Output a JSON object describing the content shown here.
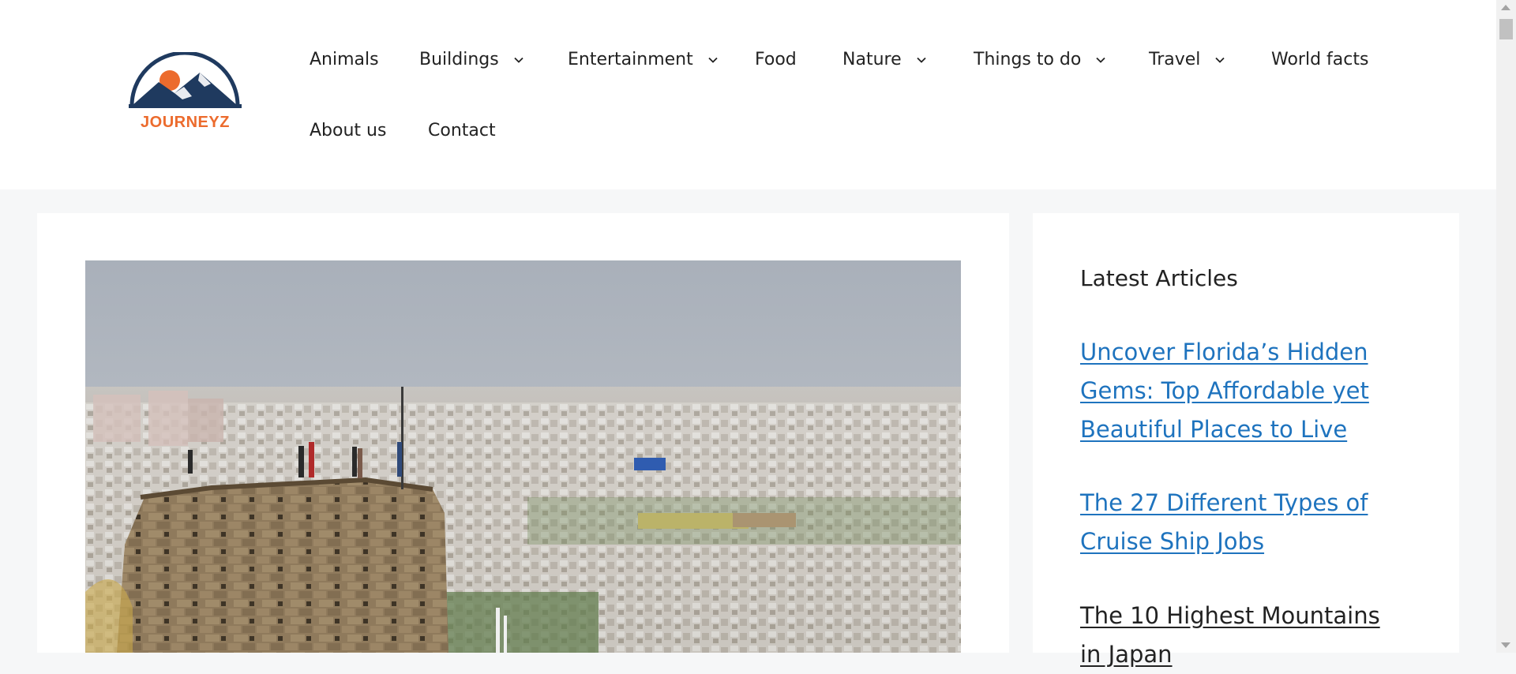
{
  "brand": {
    "name": "JOURNEYZ",
    "sun_color": "#ec6b2d",
    "mountain_color": "#1f3a5f"
  },
  "nav": {
    "items": [
      {
        "label": "Animals",
        "dropdown": false
      },
      {
        "label": "Buildings",
        "dropdown": true
      },
      {
        "label": "Entertainment",
        "dropdown": true
      },
      {
        "label": "Food",
        "dropdown": false
      },
      {
        "label": "Nature",
        "dropdown": true
      },
      {
        "label": "Things to do",
        "dropdown": true
      },
      {
        "label": "Travel",
        "dropdown": true
      },
      {
        "label": "World facts",
        "dropdown": false
      },
      {
        "label": "About us",
        "dropdown": false
      },
      {
        "label": "Contact",
        "dropdown": false
      }
    ]
  },
  "sidebar": {
    "title": "Latest Articles",
    "articles": [
      {
        "title": "Uncover Florida’s Hidden Gems: Top Affordable yet Beautiful Places to Live"
      },
      {
        "title": "The 27 Different Types of Cruise Ship Jobs"
      },
      {
        "title": "The 10 Highest Mountains in Japan"
      }
    ]
  },
  "colors": {
    "link": "#1e73be",
    "page_bg": "#f6f7f8",
    "text": "#222222"
  }
}
